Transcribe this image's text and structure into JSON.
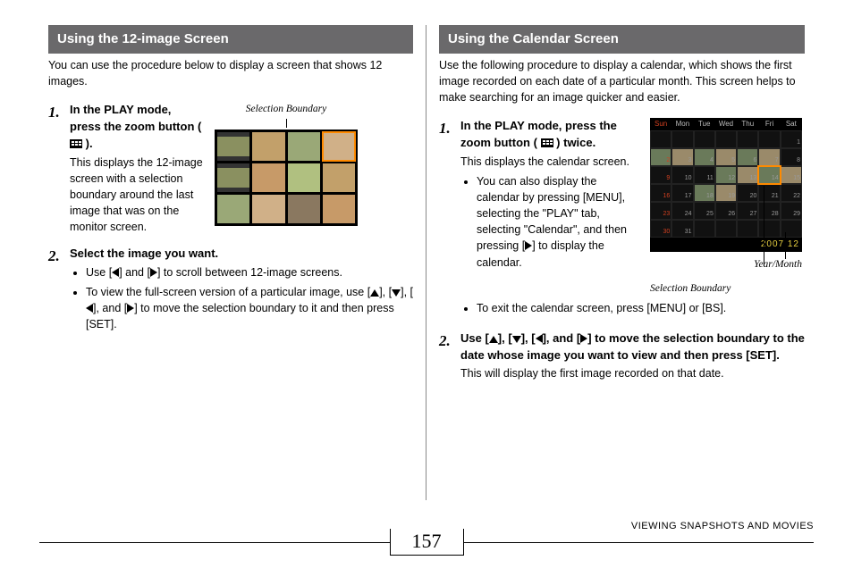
{
  "left": {
    "header": "Using the 12-image Screen",
    "intro": "You can use the procedure below to display a screen that shows 12 images.",
    "step1": {
      "num": "1.",
      "title_a": "In the PLAY mode, press the zoom button (",
      "title_b": ").",
      "desc": "This displays the 12-image screen with a selection boundary around the last image that was on the monitor screen.",
      "caption": "Selection Boundary"
    },
    "step2": {
      "num": "2.",
      "title": "Select the image you want.",
      "b1a": "Use [",
      "b1b": "] and [",
      "b1c": "] to scroll between 12-image screens.",
      "b2a": "To view the full-screen version of a particular image, use [",
      "b2b": "], [",
      "b2c": "], [",
      "b2d": "], and [",
      "b2e": "] to move the selection boundary to it and then press [SET]."
    }
  },
  "right": {
    "header": "Using the Calendar Screen",
    "intro": "Use the following procedure to display a calendar, which shows the first image recorded on each date of a particular month. This screen helps to make searching for an image quicker and easier.",
    "step1": {
      "num": "1.",
      "title_a": "In the PLAY mode, press the zoom button (",
      "title_b": ") twice.",
      "desc": "This displays the calendar screen.",
      "b1a": "You can also display the calendar by pressing [MENU], selecting the \"PLAY\" tab, selecting \"Calendar\", and then pressing [",
      "b1b": "] to display the calendar.",
      "b2": "To exit the calendar screen, press [MENU] or [BS].",
      "caption_ym": "Year/Month",
      "caption_sb": "Selection Boundary",
      "cal_days": [
        "Sun",
        "Mon",
        "Tue",
        "Wed",
        "Thu",
        "Fri",
        "Sat"
      ],
      "cal_foot": "2007.12",
      "cal_numbers": [
        "",
        "",
        "",
        "",
        "",
        "",
        "1",
        "2",
        "3",
        "4",
        "5",
        "6",
        "7",
        "8",
        "9",
        "10",
        "11",
        "12",
        "13",
        "14",
        "15",
        "16",
        "17",
        "18",
        "19",
        "20",
        "21",
        "22",
        "23",
        "24",
        "25",
        "26",
        "27",
        "28",
        "29",
        "30",
        "31",
        "",
        "",
        "",
        "",
        ""
      ]
    },
    "step2": {
      "num": "2.",
      "title_a": "Use [",
      "title_b": "], [",
      "title_c": "], [",
      "title_d": "], and [",
      "title_e": "] to move the selection boundary to the date whose image you want to view and then press [SET].",
      "desc": "This will display the first image recorded on that date."
    }
  },
  "footer": {
    "page": "157",
    "label": "VIEWING SNAPSHOTS AND MOVIES"
  }
}
